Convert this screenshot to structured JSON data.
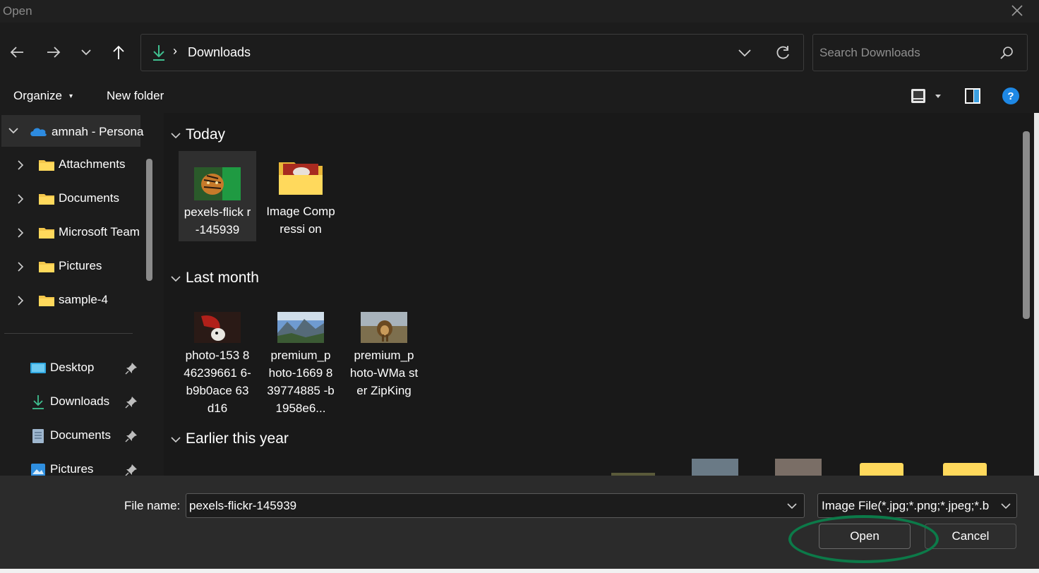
{
  "window": {
    "title": "Open",
    "close_icon": "close-icon"
  },
  "nav": {
    "back_icon": "back-arrow-icon",
    "forward_icon": "forward-arrow-icon",
    "recent_icon": "chevron-down-icon",
    "up_icon": "up-arrow-icon"
  },
  "address": {
    "location_icon": "download-icon",
    "separator": "›",
    "crumb": "Downloads",
    "dropdown_icon": "chevron-down-icon",
    "refresh_icon": "refresh-icon"
  },
  "search": {
    "placeholder": "Search Downloads",
    "icon": "search-icon"
  },
  "toolbar": {
    "organize_label": "Organize",
    "organize_caret": "▾",
    "new_folder_label": "New folder",
    "view_icon": "view-options-icon",
    "preview_pane_icon": "preview-pane-icon",
    "help_icon": "help-icon"
  },
  "sidebar": {
    "onedrive": {
      "label": "amnah - Persona",
      "icon": "cloud-icon",
      "expanded": true
    },
    "folders": [
      {
        "label": "Attachments",
        "icon": "folder-icon"
      },
      {
        "label": "Documents",
        "icon": "folder-icon"
      },
      {
        "label": "Microsoft Team",
        "icon": "folder-icon"
      },
      {
        "label": "Pictures",
        "icon": "folder-icon"
      },
      {
        "label": "sample-4",
        "icon": "folder-icon"
      }
    ],
    "quick_access": [
      {
        "label": "Desktop",
        "icon": "desktop-icon",
        "pinned": true
      },
      {
        "label": "Downloads",
        "icon": "download-icon",
        "pinned": true
      },
      {
        "label": "Documents",
        "icon": "document-icon",
        "pinned": true
      },
      {
        "label": "Pictures",
        "icon": "pictures-icon",
        "pinned": true
      }
    ]
  },
  "content": {
    "groups": [
      {
        "label": "Today",
        "items": [
          {
            "name": "pexels-flick r-145939",
            "type": "image",
            "selected": true,
            "colors": [
              "#1f7a3a",
              "#c77a2a"
            ]
          },
          {
            "name": "Image Compressi on",
            "type": "folder",
            "selected": false,
            "colors": [
              "#f3c64b",
              "#a82a20"
            ]
          }
        ]
      },
      {
        "label": "Last month",
        "items": [
          {
            "name": "photo-153 846239661 6-b9b0ace 63d16",
            "type": "image",
            "selected": false,
            "colors": [
              "#2a1a16",
              "#b1201a"
            ]
          },
          {
            "name": "premium_p hoto-1669 839774885 -b1958e6...",
            "type": "image",
            "selected": false,
            "colors": [
              "#6f9bd1",
              "#3b5a34"
            ]
          },
          {
            "name": "premium_p hoto-WMa ster ZipKing",
            "type": "image",
            "selected": false,
            "colors": [
              "#7d6f4e",
              "#a8b3bb"
            ]
          }
        ]
      },
      {
        "label": "Earlier this year",
        "items": []
      }
    ]
  },
  "footer": {
    "filename_label": "File name:",
    "filename_value": "pexels-flickr-145939",
    "filetype_value": "Image File(*.jpg;*.png;*.jpeg;*.b",
    "open_label": "Open",
    "cancel_label": "Cancel",
    "highlight_color": "#0c7a49"
  }
}
